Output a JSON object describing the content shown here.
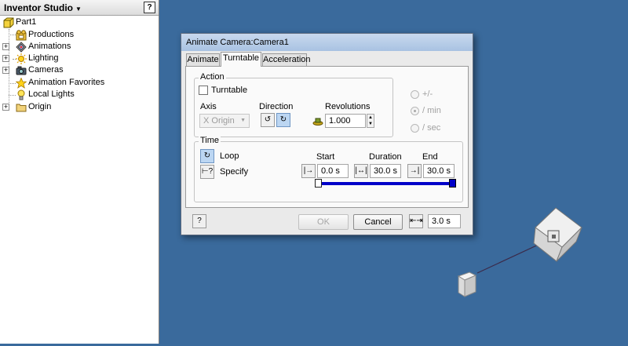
{
  "browser": {
    "title": "Inventor Studio",
    "help_icon": "?",
    "tree": [
      {
        "label": "Part1",
        "icon": "part-icon"
      },
      {
        "label": "Productions",
        "icon": "productions-icon"
      },
      {
        "label": "Animations",
        "icon": "animations-icon"
      },
      {
        "label": "Lighting",
        "icon": "lighting-icon"
      },
      {
        "label": "Cameras",
        "icon": "camera-icon"
      },
      {
        "label": "Animation Favorites",
        "icon": "star-icon"
      },
      {
        "label": "Local Lights",
        "icon": "bulb-icon"
      },
      {
        "label": "Origin",
        "icon": "folder-icon"
      }
    ]
  },
  "dialog": {
    "title": "Animate Camera:Camera1",
    "tabs": [
      "Animate",
      "Turntable",
      "Acceleration"
    ],
    "active_tab": "Turntable",
    "action": {
      "group_title": "Action",
      "turntable_label": "Turntable",
      "turntable_checked": false,
      "axis_label": "Axis",
      "axis_value": "X Origin",
      "direction_label": "Direction",
      "revolutions_label": "Revolutions",
      "revolutions_value": "1.000",
      "radio_options": [
        "+/-",
        "/ min",
        "/ sec"
      ],
      "radio_selected": "/ min"
    },
    "time": {
      "group_title": "Time",
      "loop_label": "Loop",
      "specify_label": "Specify",
      "start_label": "Start",
      "start_value": "0.0 s",
      "duration_label": "Duration",
      "duration_value": "30.0 s",
      "end_label": "End",
      "end_value": "30.0 s",
      "timeline_fill": 1.0
    },
    "footer": {
      "help_icon": "?",
      "ok_label": "OK",
      "cancel_label": "Cancel",
      "time_value": "3.0 s"
    }
  },
  "colors": {
    "viewport_bg": "#3a6a9c",
    "timeline_blue": "#0000c8",
    "titlebar": "#b8cde8"
  }
}
